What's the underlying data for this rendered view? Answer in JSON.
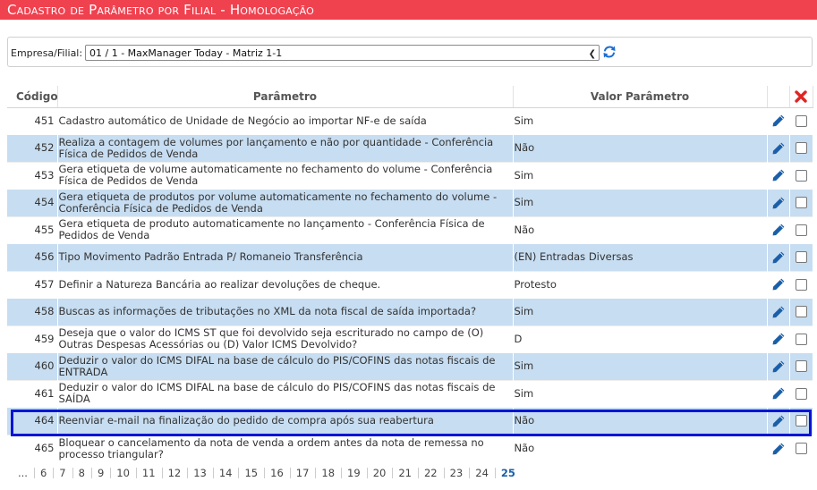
{
  "title": "Cadastro de Parâmetro por Filial  - Homologação",
  "filter": {
    "label": "Empresa/Filial:",
    "selected": "01 / 1 - MaxManager Today - Matriz 1-1"
  },
  "table": {
    "headers": {
      "code": "Código",
      "param": "Parâmetro",
      "value": "Valor Parâmetro"
    },
    "rows": [
      {
        "code": "451",
        "param": "Cadastro automático de Unidade de Negócio ao importar NF-e de saída",
        "value": "Sim"
      },
      {
        "code": "452",
        "param": "Realiza a contagem de volumes por lançamento e não por quantidade - Conferência Física de Pedidos de Venda",
        "value": "Não"
      },
      {
        "code": "453",
        "param": "Gera etiqueta de volume automaticamente no fechamento do volume - Conferência Física de Pedidos de Venda",
        "value": "Sim"
      },
      {
        "code": "454",
        "param": "Gera etiqueta de produtos por volume automaticamente no fechamento do volume - Conferência Física de Pedidos de Venda",
        "value": "Sim"
      },
      {
        "code": "455",
        "param": "Gera etiqueta de produto automaticamente no lançamento - Conferência Física de Pedidos de Venda",
        "value": "Não"
      },
      {
        "code": "456",
        "param": "Tipo Movimento Padrão Entrada P/ Romaneio Transferência",
        "value": "(EN) Entradas Diversas"
      },
      {
        "code": "457",
        "param": "Definir a Natureza Bancária ao realizar devoluções de cheque.",
        "value": "Protesto"
      },
      {
        "code": "458",
        "param": "Buscas as informações de tributações no XML da nota fiscal de saída importada?",
        "value": "Sim"
      },
      {
        "code": "459",
        "param": "Deseja que o valor do ICMS ST que foi devolvido seja escriturado no campo de (O) Outras Despesas Acessórias ou (D) Valor ICMS Devolvido?",
        "value": "D"
      },
      {
        "code": "460",
        "param": "Deduzir o valor do ICMS DIFAL na base de cálculo do PIS/COFINS das notas fiscais de ENTRADA",
        "value": "Sim"
      },
      {
        "code": "461",
        "param": "Deduzir o valor do ICMS DIFAL na base de cálculo do PIS/COFINS das notas fiscais de SAÍDA",
        "value": "Sim"
      },
      {
        "code": "464",
        "param": "Reenviar e-mail na finalização do pedido de compra após sua reabertura",
        "value": "Não"
      },
      {
        "code": "465",
        "param": "Bloquear o cancelamento da nota de venda a ordem antes da nota de remessa no processo triangular?",
        "value": "Não"
      }
    ]
  },
  "pagination": {
    "pages": [
      "...",
      "6",
      "7",
      "8",
      "9",
      "10",
      "11",
      "12",
      "13",
      "14",
      "15",
      "16",
      "17",
      "18",
      "19",
      "20",
      "21",
      "22",
      "23",
      "24",
      "25"
    ],
    "current": "25"
  },
  "colors": {
    "title_bar": "#f0414f",
    "row_alt": "#c7ddf1",
    "highlight_border": "#0a14d6",
    "edit_icon": "#1b5fa8",
    "delete_icon": "#e02424"
  },
  "icons": {
    "refresh": "refresh-icon",
    "edit": "pencil-icon",
    "delete": "delete-icon"
  }
}
